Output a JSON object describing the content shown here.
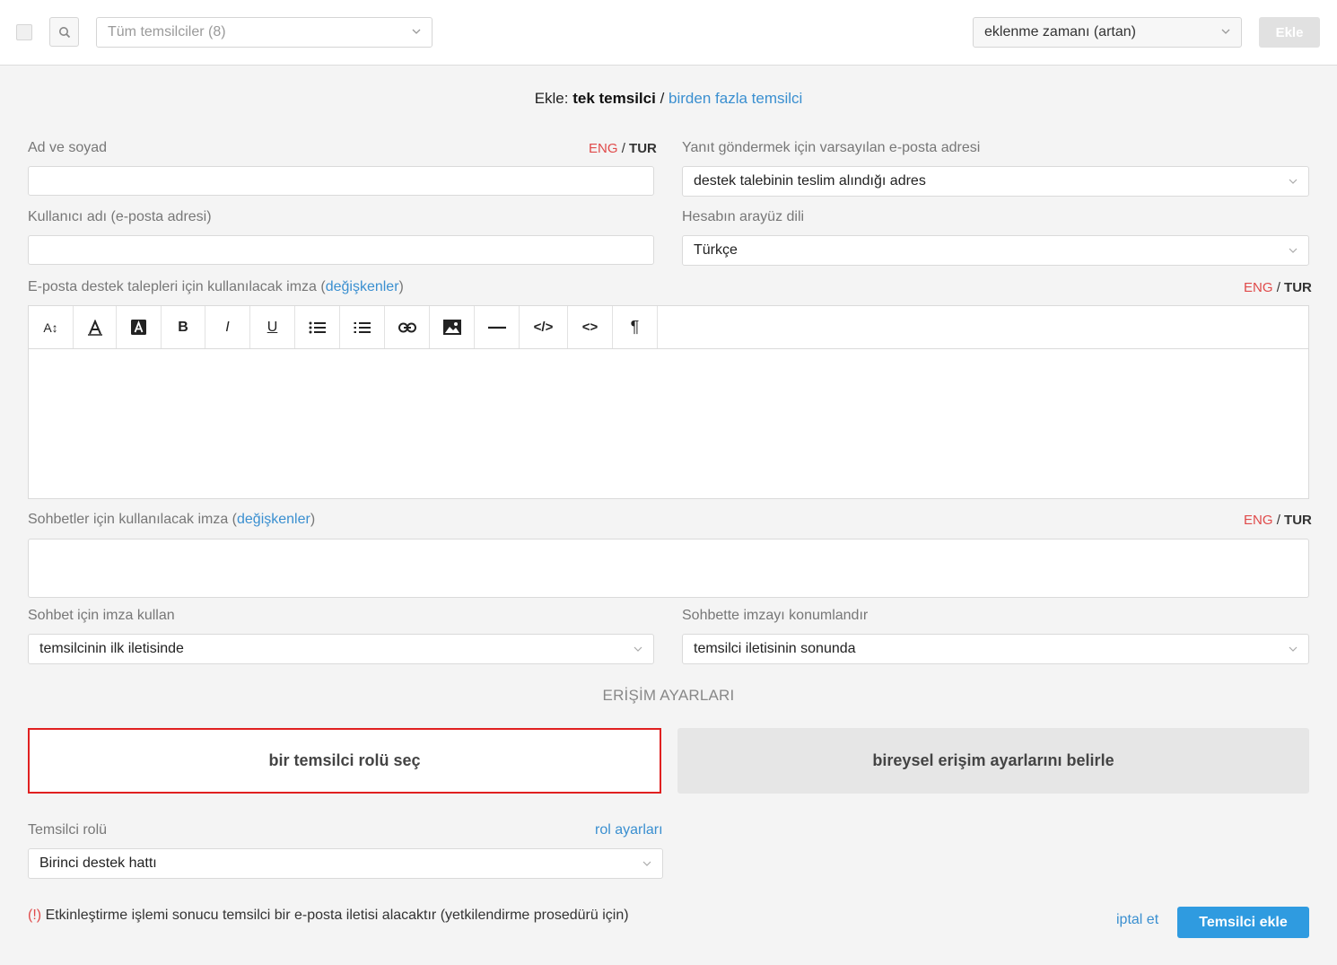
{
  "topbar": {
    "filter_placeholder": "Tüm temsilciler (8)",
    "sort_value": "eklenme zamanı (artan)",
    "add_label": "Ekle"
  },
  "mode": {
    "prefix": "Ekle:",
    "single": "tek temsilci",
    "sep": "/",
    "multiple": "birden fazla temsilci"
  },
  "form": {
    "fullname_label": "Ad ve soyad",
    "username_label": "Kullanıcı adı (e-posta adresi)",
    "reply_email_label": "Yanıt göndermek için varsayılan e-posta adresi",
    "reply_email_value": "destek talebinin teslim alındığı adres",
    "ui_lang_label": "Hesabın arayüz dili",
    "ui_lang_value": "Türkçe",
    "email_sig_label_pre": "E-posta destek talepleri için kullanılacak imza (",
    "email_sig_link": "değişkenler",
    "email_sig_label_post": ")",
    "chat_sig_label_pre": "Sohbetler için kullanılacak imza (",
    "chat_sig_link": "değişkenler",
    "chat_sig_label_post": ")",
    "chat_use_label": "Sohbet için imza kullan",
    "chat_use_value": "temsilcinin ilk iletisinde",
    "chat_pos_label": "Sohbette imzayı konumlandır",
    "chat_pos_value": "temsilci iletisinin sonunda"
  },
  "lang_switch": {
    "eng": "ENG",
    "sep": "/",
    "tur": "TUR"
  },
  "toolbar": {
    "fontsize": "A↕",
    "bold": "B",
    "italic": "I",
    "underline": "U",
    "code": "</>",
    "source": "<>",
    "paragraph": "¶"
  },
  "access": {
    "title": "ERİŞİM AYARLARI",
    "choice_role": "bir temsilci rolü seç",
    "choice_individual": "bireysel erişim ayarlarını belirle",
    "role_label": "Temsilci rolü",
    "role_settings_link": "rol ayarları",
    "role_value": "Birinci destek hattı"
  },
  "footer": {
    "warn_mark": "(!)",
    "note": "Etkinleştirme işlemi sonucu temsilci bir e-posta iletisi alacaktır (yetkilendirme prosedürü için)",
    "cancel": "iptal et",
    "submit": "Temsilci ekle"
  },
  "colors": {
    "accent": "#2f9be0",
    "link": "#3a8fd0",
    "warning": "#e04a4a",
    "selection_border": "#e02020"
  }
}
